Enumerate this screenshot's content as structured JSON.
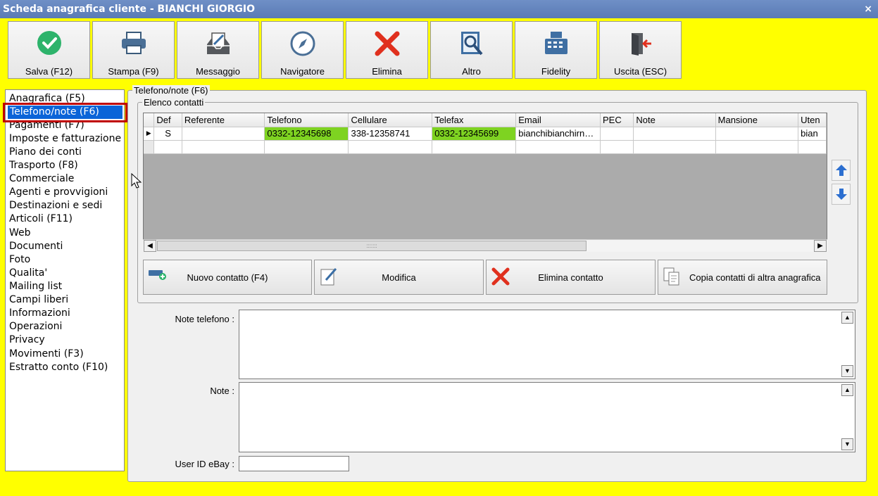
{
  "window": {
    "title": "Scheda anagrafica cliente - BIANCHI GIORGIO",
    "close_glyph": "×"
  },
  "toolbar": {
    "buttons": [
      {
        "label": "Salva (F12)",
        "icon": "check-circle-icon"
      },
      {
        "label": "Stampa (F9)",
        "icon": "printer-icon"
      },
      {
        "label": "Messaggio",
        "icon": "message-icon"
      },
      {
        "label": "Navigatore",
        "icon": "compass-icon"
      },
      {
        "label": "Elimina",
        "icon": "delete-x-icon"
      },
      {
        "label": "Altro",
        "icon": "search-book-icon"
      },
      {
        "label": "Fidelity",
        "icon": "cash-register-icon"
      },
      {
        "label": "Uscita (ESC)",
        "icon": "exit-door-icon"
      }
    ]
  },
  "nav": {
    "items": [
      "Anagrafica (F5)",
      "Telefono/note (F6)",
      "Pagamenti (F7)",
      "Imposte e fatturazione",
      "Piano dei conti",
      "Trasporto (F8)",
      "Commerciale",
      "Agenti e provvigioni",
      "Destinazioni e sedi",
      "Articoli (F11)",
      "Web",
      "Documenti",
      "Foto",
      "Qualita'",
      "Mailing list",
      "Campi liberi",
      "Informazioni",
      "Operazioni",
      "Privacy",
      "Movimenti (F3)",
      "Estratto conto (F10)"
    ],
    "selected": "Telefono/note (F6)"
  },
  "panel": {
    "title": "Telefono/note (F6)",
    "group_title": "Elenco contatti"
  },
  "grid": {
    "columns": [
      "",
      "Def",
      "Referente",
      "Telefono",
      "Cellulare",
      "Telefax",
      "Email",
      "PEC",
      "Note",
      "Mansione",
      "Uten"
    ],
    "row": {
      "indicator": "▶",
      "def": "S",
      "referente": "",
      "telefono": "0332-12345698",
      "cellulare": "338-12358741",
      "telefax": "0332-12345699",
      "email": "bianchibianchirn…",
      "pec": "",
      "note": "",
      "mansione": "",
      "utente": "bian"
    },
    "highlight_color": "#7ed321",
    "scroll_left": "◀",
    "scroll_right": "▶",
    "grip": ":::::::"
  },
  "actions": {
    "new_contact": "Nuovo contatto (F4)",
    "edit": "Modifica",
    "delete_contact": "Elimina contatto",
    "copy_contacts": "Copia contatti di altra anagrafica",
    "move_up_glyph": "↑",
    "move_down_glyph": "↓"
  },
  "fields": {
    "note_telefono_label": "Note telefono :",
    "note_telefono_value": "",
    "note_label": "Note :",
    "note_value": "",
    "user_id_ebay_label": "User ID eBay :",
    "user_id_ebay_value": "",
    "scroll_up": "▲",
    "scroll_down": "▼"
  },
  "colors": {
    "background": "#ffff00",
    "titlebar": "#5a7bb5",
    "selection": "#0a64d8",
    "highlight_box": "#c00000"
  }
}
